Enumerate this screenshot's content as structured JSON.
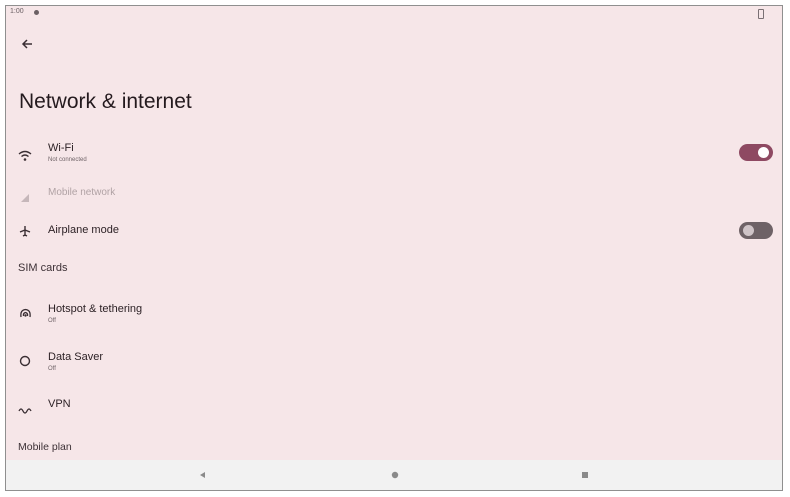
{
  "status_bar": {
    "time": "1:00"
  },
  "header": {
    "title": "Network & internet"
  },
  "items": [
    {
      "title": "Wi-Fi",
      "subtitle": "Not connected",
      "icon": "wifi-icon",
      "toggle": "on"
    },
    {
      "title": "Mobile network",
      "icon": "signal-icon",
      "disabled": true
    },
    {
      "title": "Airplane mode",
      "icon": "airplane-icon",
      "toggle": "off"
    },
    {
      "title": "Hotspot & tethering",
      "subtitle": "Off",
      "icon": "hotspot-icon"
    },
    {
      "title": "Data Saver",
      "subtitle": "Off",
      "icon": "data-saver-icon"
    },
    {
      "title": "VPN",
      "icon": "vpn-icon"
    }
  ],
  "sections": {
    "sim_cards": "SIM cards",
    "mobile_plan": "Mobile plan"
  },
  "colors": {
    "background": "#f6e6e8",
    "accent": "#8e4962",
    "toggle_off": "#6e6266"
  }
}
